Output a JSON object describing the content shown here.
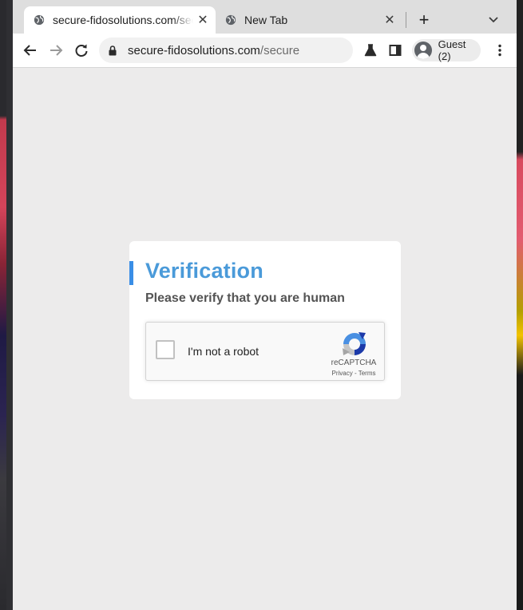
{
  "browser": {
    "tabs": [
      {
        "title": "secure-fidosolutions.com/secure",
        "active": true,
        "close": "✕"
      },
      {
        "title": "New Tab",
        "active": false,
        "close": "✕"
      }
    ],
    "new_tab_label": "+",
    "address": {
      "host": "secure-fidosolutions.com",
      "path": "/secure"
    },
    "profile_label": "Guest (2)",
    "icons": [
      "back-icon",
      "forward-icon",
      "reload-icon",
      "lock-icon",
      "labs-flask-icon",
      "side-panel-icon",
      "avatar-icon",
      "menu-icon",
      "tab-search-icon",
      "globe-icon"
    ]
  },
  "page": {
    "heading": "Verification",
    "subheading": "Please verify that you are human",
    "recaptcha": {
      "checkbox_label": "I'm not a robot",
      "brand": "reCAPTCHA",
      "privacy": "Privacy",
      "separator": " - ",
      "terms": "Terms",
      "checked": false
    }
  },
  "colors": {
    "accent": "#3a8ee6",
    "heading": "#4a9ad9",
    "page_bg": "#ecebeb"
  }
}
